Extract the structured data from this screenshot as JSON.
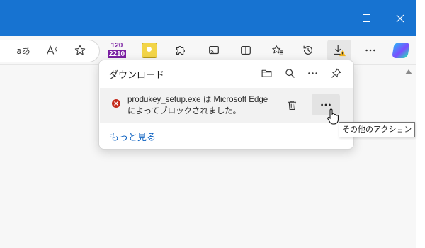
{
  "window": {
    "controls": {
      "minimize_icon": "minimize-icon",
      "maximize_icon": "maximize-icon",
      "close_icon": "close-icon"
    }
  },
  "toolbar": {
    "read_aloud_label": "aあ",
    "extension_counter": {
      "top": "120",
      "bottom": "2210"
    }
  },
  "downloads_flyout": {
    "title": "ダウンロード",
    "item": {
      "status": "error",
      "text": "produkey_setup.exe は Microsoft Edge によってブロックされました。"
    },
    "see_more": "もっと見る"
  },
  "tooltip": "その他のアクション",
  "colors": {
    "titlebar": "#1773d1",
    "link": "#0f63c2",
    "error": "#c42b1c",
    "counter_badge": "#7a1fa2"
  }
}
